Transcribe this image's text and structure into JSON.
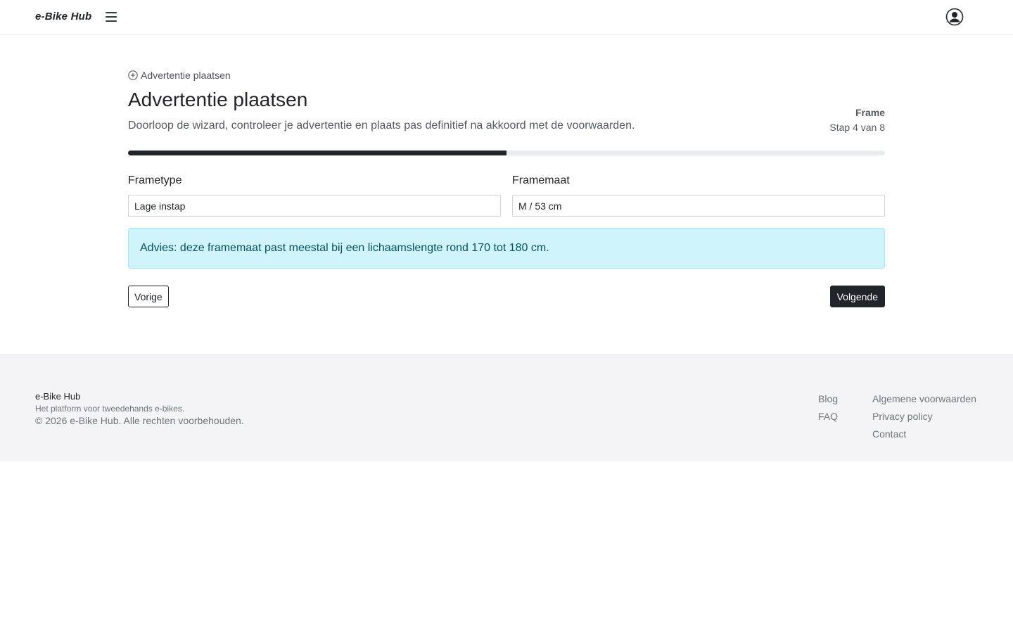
{
  "header": {
    "logo": "e-Bike Hub",
    "menu_icon": "hamburger-menu-icon",
    "account_icon": "user-circle-icon"
  },
  "main": {
    "breadcrumb_icon": "plus-circle-icon",
    "breadcrumb": "Advertentie plaatsen",
    "title": "Advertentie plaatsen",
    "description": "Doorloop de wizard, controleer je advertentie en plaats pas definitief na akkoord met de voorwaarden.",
    "step_name": "Frame",
    "step_count": "Stap 4 van 8",
    "progress": {
      "current": 4,
      "total": 8
    },
    "fields": {
      "frametype": {
        "label": "Frametype",
        "value": "Lage instap"
      },
      "framemaat": {
        "label": "Framemaat",
        "value": "M / 53 cm"
      }
    },
    "advice": "Advies: deze framemaat past meestal bij een lichaamslengte rond 170 tot 180 cm.",
    "prev_label": "Vorige",
    "next_label": "Volgende"
  },
  "footer": {
    "brand": "e-Bike Hub",
    "tagline": "Het platform voor tweedehands e-bikes.",
    "copyright": "© 2026 e-Bike Hub. Alle rechten voorbehouden.",
    "links_col1": [
      "Blog",
      "FAQ"
    ],
    "links_col2": [
      "Algemene voorwaarden",
      "Privacy policy",
      "Contact"
    ]
  },
  "colors": {
    "primary": "#212529",
    "alert_bg": "#cff4fc",
    "alert_text": "#055160",
    "footer_bg": "#f4f4f6"
  }
}
